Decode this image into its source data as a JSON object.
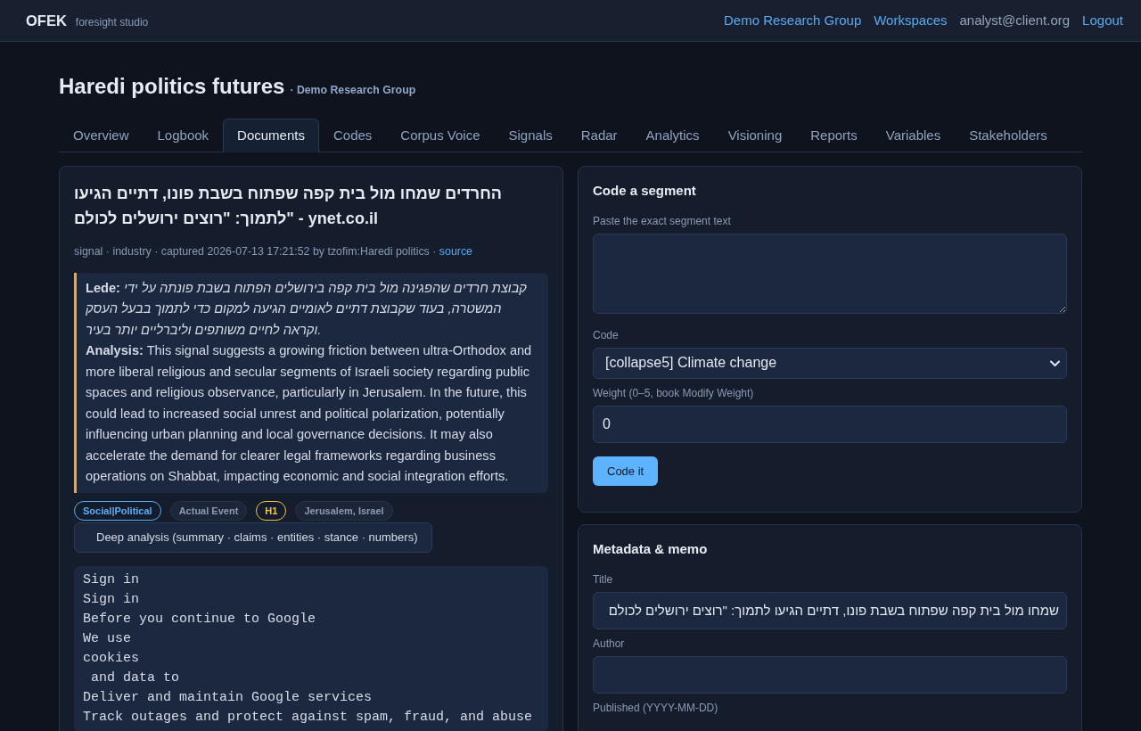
{
  "navbar": {
    "brand": "OFEK",
    "tagline": "foresight studio",
    "items": [
      {
        "label": "Demo Research Group",
        "kind": "link"
      },
      {
        "label": "Workspaces",
        "kind": "link"
      },
      {
        "label": "analyst@client.org",
        "kind": "text"
      },
      {
        "label": "Logout",
        "kind": "link"
      }
    ]
  },
  "page": {
    "title": "Haredi politics futures",
    "group": "· Demo Research Group"
  },
  "tabs": [
    {
      "label": "Overview",
      "selected": false
    },
    {
      "label": "Logbook",
      "selected": false
    },
    {
      "label": "Documents",
      "selected": true
    },
    {
      "label": "Codes",
      "selected": false
    },
    {
      "label": "Corpus Voice",
      "selected": false
    },
    {
      "label": "Signals",
      "selected": false
    },
    {
      "label": "Radar",
      "selected": false
    },
    {
      "label": "Analytics",
      "selected": false
    },
    {
      "label": "Visioning",
      "selected": false
    },
    {
      "label": "Reports",
      "selected": false
    },
    {
      "label": "Variables",
      "selected": false
    },
    {
      "label": "Stakeholders",
      "selected": false
    }
  ],
  "document": {
    "title": "החרדים שמחו מול בית קפה שפתוח בשבת פונו, דתיים הגיעו לתמוך: \"רוצים ירושלים לכולם\" - ynet.co.il",
    "meta": "signal · industry · captured 2026-07-13 17:21:52 by tzofim:Haredi politics ·",
    "source_link": "source",
    "lede": "**Lede:** *קבוצת חרדים שהפגינה מול בית קפה בירושלים הפתוח בשבת פונתה על ידי המשטרה, בעוד שקבוצת דתיים לאומיים הגיעה למקום כדי לתמוך בבעל העסק וקראה לחיים משותפים וליברליים יותר בעיר.*",
    "analysis": "**Analysis:** This signal suggests a growing friction between ultra-Orthodox and more liberal religious and secular segments of Israeli society regarding public spaces and religious observance, particularly in Jerusalem. In the future, this could lead to increased social unrest and political polarization, potentially influencing urban planning and local governance decisions. It may also accelerate the demand for clearer legal frameworks regarding business operations on Shabbat, impacting economic and social integration efforts.",
    "tags": [
      {
        "label": "Social|Political",
        "kind": "outline",
        "color": "#5aaef5"
      },
      {
        "label": "Actual Event",
        "kind": "muted",
        "color": "#8b9ab3"
      },
      {
        "label": "H1",
        "kind": "outline",
        "color": "#f2c444"
      },
      {
        "label": "Jerusalem, Israel",
        "kind": "muted",
        "color": "#8b9ab3"
      }
    ],
    "deep_analysis": "Deep analysis (summary · claims · entities · stance · numbers)",
    "content_lines": [
      "Sign in",
      "Sign in",
      "Before you continue to Google",
      "We use",
      "cookies",
      " and data to",
      "Deliver and maintain Google services",
      "Track outages and protect against spam, fraud, and abuse"
    ]
  },
  "code_segment": {
    "title": "Code a segment",
    "fields": [
      {
        "kind": "textarea",
        "label": "Paste the exact segment text"
      },
      {
        "kind": "select",
        "label": "Code",
        "value": "[collapse5] Climate change"
      },
      {
        "kind": "input",
        "label": "Weight (0–5, book Modify Weight)",
        "value": "0"
      }
    ],
    "button": "Code it"
  },
  "metadata": {
    "title": "Metadata & memo",
    "fields": [
      {
        "kind": "input",
        "label": "Title",
        "value": "שמחו מול בית קפה שפתוח בשבת פונו, דתיים הגיעו לתמוך: \"רוצים ירושלים לכולם"
      },
      {
        "kind": "input",
        "label": "Author"
      },
      {
        "kind": "label",
        "label": "Published (YYYY-MM-DD)"
      }
    ]
  }
}
